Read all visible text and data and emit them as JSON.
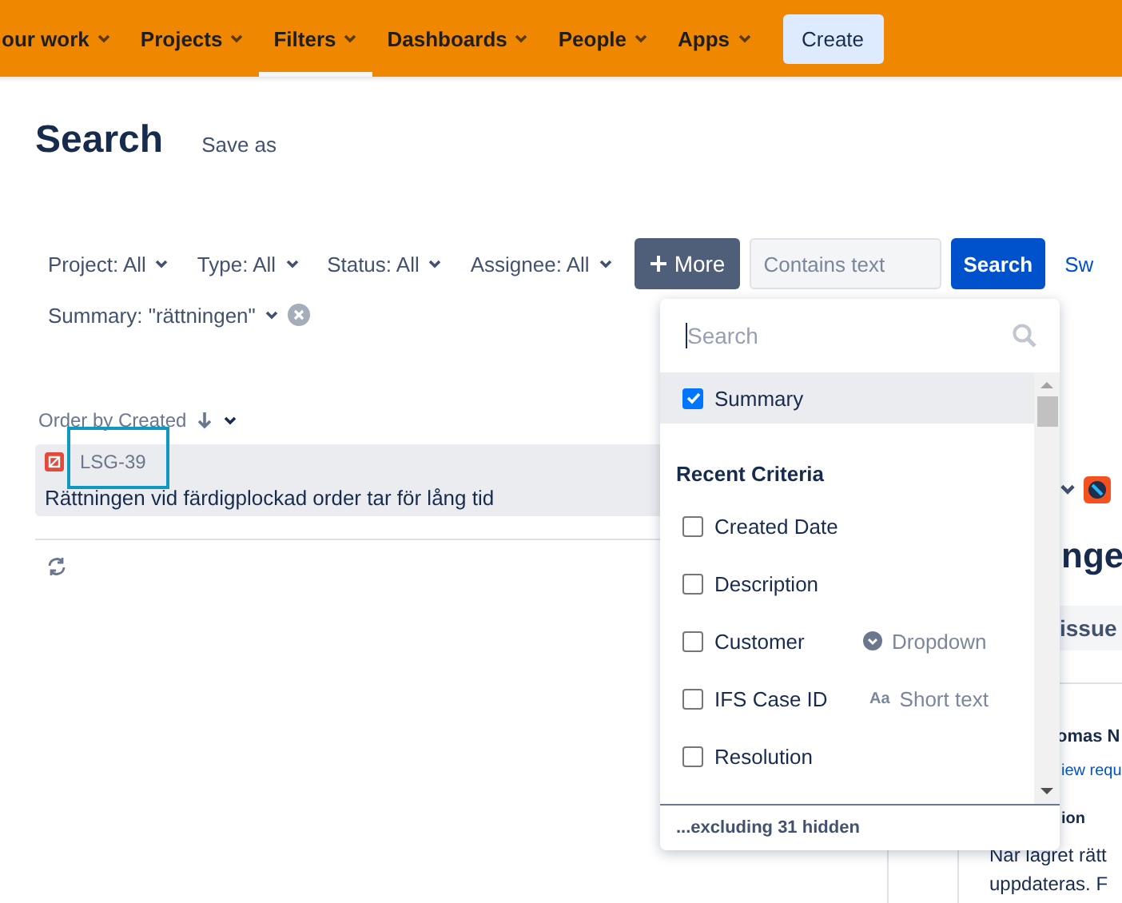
{
  "nav": {
    "items": [
      {
        "label": "our work",
        "selected": false
      },
      {
        "label": "Projects",
        "selected": false
      },
      {
        "label": "Filters",
        "selected": true
      },
      {
        "label": "Dashboards",
        "selected": false
      },
      {
        "label": "People",
        "selected": false
      },
      {
        "label": "Apps",
        "selected": false
      }
    ],
    "create_button": "Create"
  },
  "page": {
    "title": "Search",
    "save_as": "Save as"
  },
  "filters": {
    "dropdowns": [
      "Project: All",
      "Type: All",
      "Status: All",
      "Assignee: All"
    ],
    "more_button": "More",
    "text_field": {
      "placeholder": "Contains text"
    },
    "search_button": "Search",
    "switch_link": "Sw",
    "active": [
      {
        "label": "Summary: \"rättningen\""
      }
    ]
  },
  "results": {
    "order_by": "Order by Created",
    "issues": [
      {
        "key": "LSG-39",
        "summary": "Rättningen vid färdigplockad order tar för lång tid",
        "selected": true,
        "focused": true
      }
    ]
  },
  "detail": {
    "heading": "nge",
    "issue_button": "issue",
    "person": "omas N",
    "request_link": "iew requ",
    "section_label": "ion",
    "description": [
      "När lagret rätt",
      "uppdateras. F"
    ]
  },
  "criteria_menu": {
    "search": {
      "placeholder": "Search"
    },
    "selected_items": [
      {
        "label": "Summary",
        "checked": true,
        "selected": true
      }
    ],
    "section_title": "Recent Criteria",
    "recent_items": [
      {
        "label": "Created Date",
        "checked": false,
        "selected": false
      },
      {
        "label": "Description",
        "checked": false,
        "selected": false
      },
      {
        "label": "Customer",
        "checked": false,
        "selected": false,
        "field_type": {
          "kind": "select",
          "label": "Dropdown"
        }
      },
      {
        "label": "IFS Case ID",
        "checked": false,
        "selected": false,
        "field_type": {
          "kind": "text",
          "glyph": "Aa",
          "label": "Short text"
        }
      },
      {
        "label": "Resolution",
        "checked": false,
        "selected": false
      }
    ],
    "footer": "...excluding 31 hidden"
  }
}
